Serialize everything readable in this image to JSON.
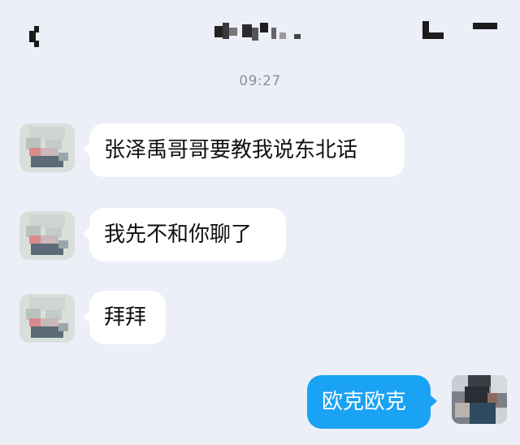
{
  "header": {
    "back_icon": "back-arrow-icon",
    "title_obscured": true,
    "menu_icon": "more-icon"
  },
  "chat": {
    "timestamp": "09:27",
    "messages": [
      {
        "direction": "incoming",
        "text": "张泽禹哥哥要教我说东北话",
        "avatar": "contact-avatar-pixelated"
      },
      {
        "direction": "incoming",
        "text": "我先不和你聊了",
        "avatar": "contact-avatar-pixelated"
      },
      {
        "direction": "incoming",
        "text": "拜拜",
        "avatar": "contact-avatar-pixelated"
      },
      {
        "direction": "outgoing",
        "text": "欧克欧克",
        "avatar": "self-avatar-pixelated"
      }
    ]
  },
  "colors": {
    "background": "#eceef8",
    "incoming_bubble": "#ffffff",
    "outgoing_bubble": "#1aa2f5",
    "timestamp_text": "#8e9099"
  }
}
